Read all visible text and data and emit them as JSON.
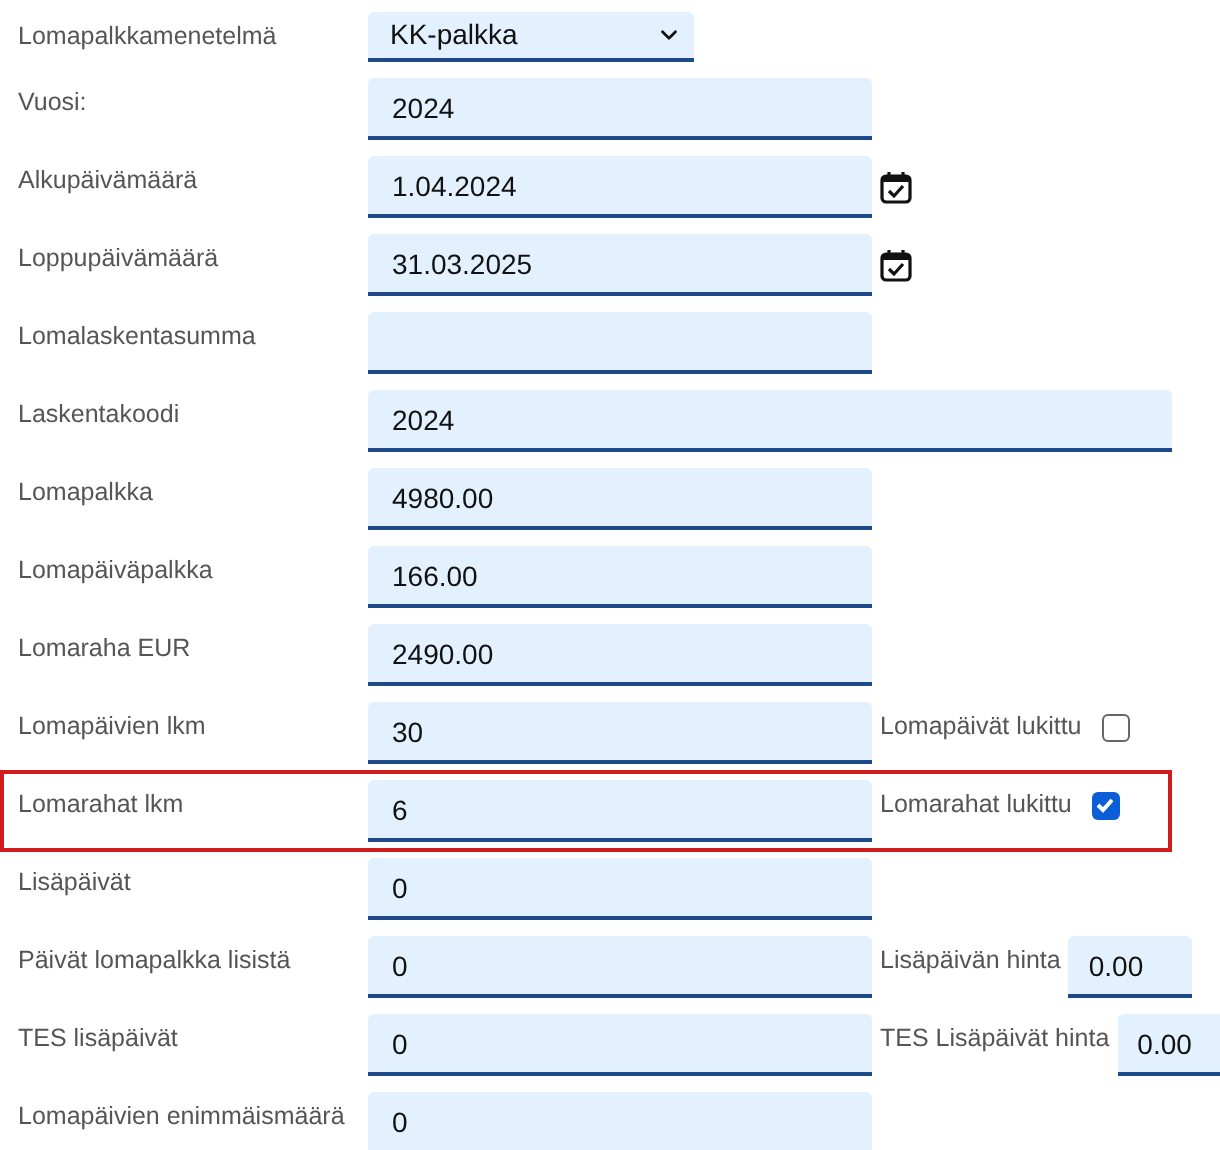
{
  "rows": [
    {
      "label": "Lomapalkkamenetelmä",
      "kind": "select",
      "value": "KK-palkka"
    },
    {
      "label": "Vuosi:",
      "kind": "text",
      "value": "2024"
    },
    {
      "label": "Alkupäivämäärä",
      "kind": "date",
      "value": "1.04.2024"
    },
    {
      "label": "Loppupäivämäärä",
      "kind": "date",
      "value": "31.03.2025"
    },
    {
      "label": "Lomalaskentasumma",
      "kind": "text"
    },
    {
      "label": "Laskentakoodi",
      "kind": "wide",
      "value": "2024"
    },
    {
      "label": "Lomapalkka",
      "kind": "text",
      "value": "4980.00"
    },
    {
      "label": "Lomapäiväpalkka",
      "kind": "text",
      "value": "166.00"
    },
    {
      "label": "Lomaraha EUR",
      "kind": "text",
      "value": "2490.00"
    },
    {
      "label": "Lomapäivien lkm",
      "kind": "text",
      "value": "30",
      "checkbox": {
        "label": "Lomapäivät lukittu",
        "checked": false
      }
    },
    {
      "label": "Lomarahat lkm",
      "kind": "text",
      "value": "6",
      "highlighted": true,
      "checkbox": {
        "label": "Lomarahat lukittu",
        "checked": true
      }
    },
    {
      "label": "Lisäpäivät",
      "kind": "text",
      "value": "0"
    },
    {
      "label": "Päivät lomapalkka lisistä",
      "kind": "text",
      "value": "0",
      "side_field": {
        "label": "Lisäpäivän hinta",
        "value": "0.00"
      }
    },
    {
      "label": "TES lisäpäivät",
      "kind": "text",
      "value": "0",
      "side_field": {
        "label": "TES Lisäpäivät hinta",
        "value": "0.00"
      }
    },
    {
      "label": "Lomapäivien enimmäismäärä",
      "kind": "text",
      "value": "0"
    }
  ]
}
